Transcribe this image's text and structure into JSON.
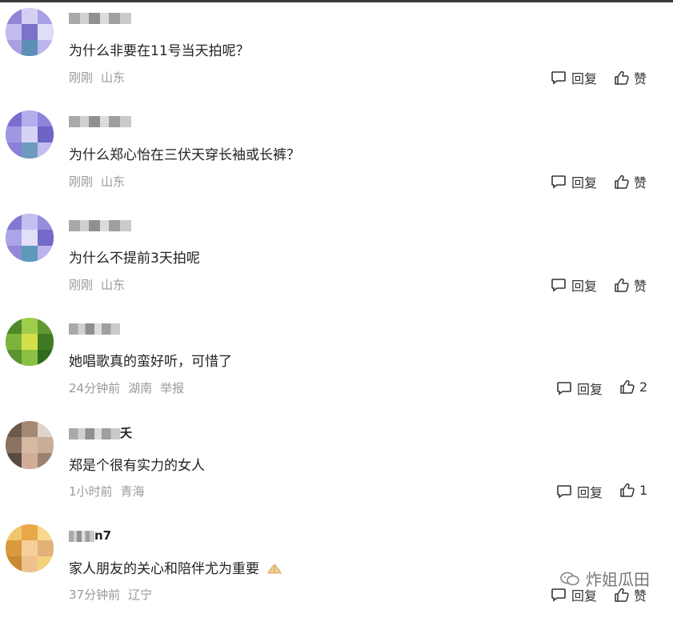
{
  "comments": [
    {
      "user": "",
      "text": "为什么非要在11号当天拍呢？",
      "meta": [
        "刚刚",
        "山东"
      ],
      "reply_label": "回复",
      "like_label": "赞"
    },
    {
      "user": "",
      "text": "为什么郑心怡在三伏天穿长袖或长裤？",
      "meta": [
        "刚刚",
        "山东"
      ],
      "reply_label": "回复",
      "like_label": "赞"
    },
    {
      "user": "",
      "text": "为什么不提前3天拍呢",
      "meta": [
        "刚刚",
        "山东"
      ],
      "reply_label": "回复",
      "like_label": "赞"
    },
    {
      "user": "",
      "text": "她唱歌真的蛮好听，可惜了",
      "meta": [
        "24分钟前",
        "湖南",
        "举报"
      ],
      "reply_label": "回复",
      "like_label": "2"
    },
    {
      "user": "夭",
      "text": "郑是个很有实力的女人",
      "meta": [
        "1小时前",
        "青海"
      ],
      "reply_label": "回复",
      "like_label": "1"
    },
    {
      "user": "n7",
      "text": "家人朋友的关心和陪伴尤为重要",
      "meta": [
        "37分钟前",
        "辽宁"
      ],
      "reply_label": "回复",
      "like_label": "赞"
    }
  ],
  "watermark": "炸姐瓜田",
  "colors": {
    "meta_gray": "#9a9a9a",
    "text": "#222222"
  }
}
